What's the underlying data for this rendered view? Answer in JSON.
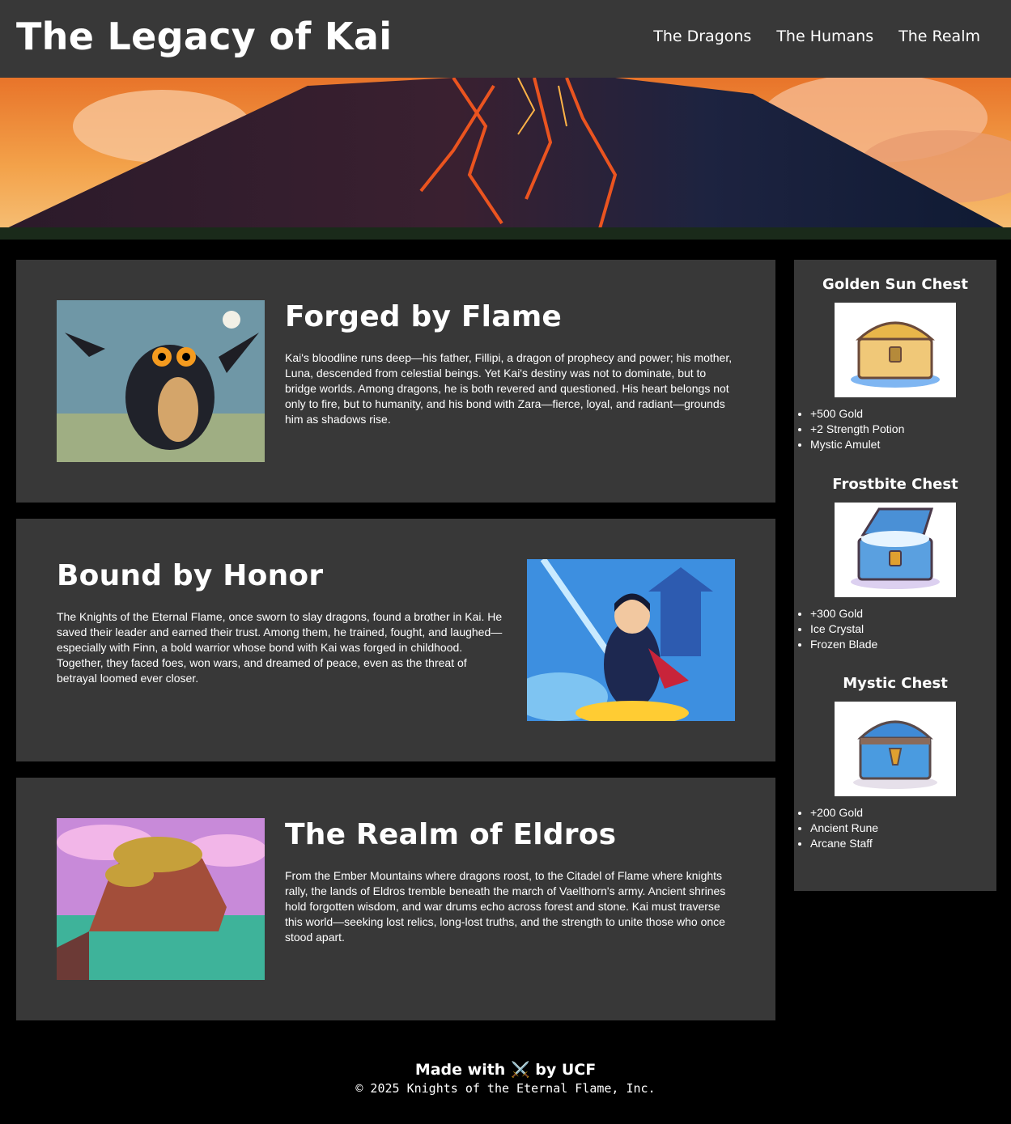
{
  "header": {
    "title": "The Legacy of Kai",
    "nav": [
      "The Dragons",
      "The Humans",
      "The Realm"
    ]
  },
  "hero": {
    "image": "volcano-landscape"
  },
  "sections": [
    {
      "title": "Forged by Flame",
      "text": "Kai's bloodline runs deep—his father, Fillipi, a dragon of prophecy and power; his mother, Luna, descended from celestial beings. Yet Kai's destiny was not to dominate, but to bridge worlds. Among dragons, he is both revered and questioned. His heart belongs not only to fire, but to humanity, and his bond with Zara—fierce, loyal, and radiant—grounds him as shadows rise.",
      "image": "black-dragon"
    },
    {
      "title": "Bound by Honor",
      "text": "The Knights of the Eternal Flame, once sworn to slay dragons, found a brother in Kai. He saved their leader and earned their trust. Among them, he trained, fought, and laughed—especially with Finn, a bold warrior whose bond with Kai was forged in childhood. Together, they faced foes, won wars, and dreamed of peace, even as the threat of betrayal loomed ever closer.",
      "image": "knight-warrior"
    },
    {
      "title": "The Realm of Eldros",
      "text": "From the Ember Mountains where dragons roost, to the Citadel of Flame where knights rally, the lands of Eldros tremble beneath the march of Vaelthorn's army. Ancient shrines hold forgotten wisdom, and war drums echo across forest and stone. Kai must traverse this world—seeking lost relics, long-lost truths, and the strength to unite those who once stood apart.",
      "image": "island-landscape"
    }
  ],
  "sidebar": {
    "chests": [
      {
        "title": "Golden Sun Chest",
        "items": [
          "+500 Gold",
          "+2 Strength Potion",
          "Mystic Amulet"
        ],
        "image": "golden-chest"
      },
      {
        "title": "Frostbite Chest",
        "items": [
          "+300 Gold",
          "Ice Crystal",
          "Frozen Blade"
        ],
        "image": "frost-chest"
      },
      {
        "title": "Mystic Chest",
        "items": [
          "+200 Gold",
          "Ancient Rune",
          "Arcane Staff"
        ],
        "image": "mystic-chest"
      }
    ]
  },
  "footer": {
    "made_with": "Made with ⚔️ by UCF",
    "copyright": "© 2025 Knights of the Eternal Flame, Inc."
  }
}
